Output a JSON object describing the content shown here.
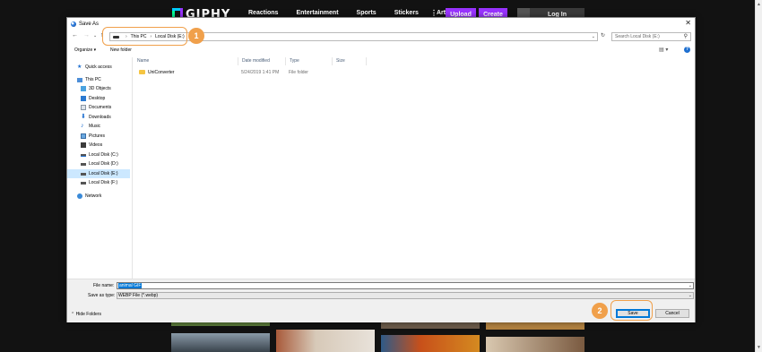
{
  "giphy": {
    "logo": "GIPHY",
    "nav": [
      "Reactions",
      "Entertainment",
      "Sports",
      "Stickers",
      "Artists"
    ],
    "upload": "Upload",
    "create": "Create",
    "login": "Log In",
    "brand_color": "#9933ff"
  },
  "dialog": {
    "title": "Save As",
    "address": {
      "segments": [
        "This PC",
        "Local Disk (E:)"
      ]
    },
    "search_placeholder": "Search Local Disk (E:)",
    "toolbar": {
      "organize": "Organize ▾",
      "new_folder": "New folder"
    },
    "nav_items": [
      {
        "label": "Quick access",
        "icon": "star-icon"
      },
      {
        "label": "This PC",
        "icon": "computer-icon"
      },
      {
        "label": "3D Objects",
        "icon": "cube-icon"
      },
      {
        "label": "Desktop",
        "icon": "desktop-icon"
      },
      {
        "label": "Documents",
        "icon": "document-icon"
      },
      {
        "label": "Downloads",
        "icon": "download-icon"
      },
      {
        "label": "Music",
        "icon": "music-icon"
      },
      {
        "label": "Pictures",
        "icon": "picture-icon"
      },
      {
        "label": "Videos",
        "icon": "video-icon"
      },
      {
        "label": "Local Disk (C:)",
        "icon": "drive-icon"
      },
      {
        "label": "Local Disk (D:)",
        "icon": "drive-icon"
      },
      {
        "label": "Local Disk (E:)",
        "icon": "drive-icon",
        "selected": true
      },
      {
        "label": "Local Disk (F:)",
        "icon": "drive-icon"
      },
      {
        "label": "Network",
        "icon": "network-icon"
      }
    ],
    "columns": [
      "Name",
      "Date modified",
      "Type",
      "Size"
    ],
    "files": [
      {
        "name": "UniConverter",
        "date": "5/24/2019 1:41 PM",
        "type": "File folder",
        "size": ""
      }
    ],
    "file_name_label": "File name:",
    "file_name_value": "animal GIF",
    "save_as_type_label": "Save as type:",
    "save_as_type_value": "WEBP File (*.webp)",
    "hide_folders": "Hide Folders",
    "save": "Save",
    "cancel": "Cancel"
  },
  "annotations": [
    "1",
    "2"
  ],
  "annotation_color": "#f0a04b"
}
